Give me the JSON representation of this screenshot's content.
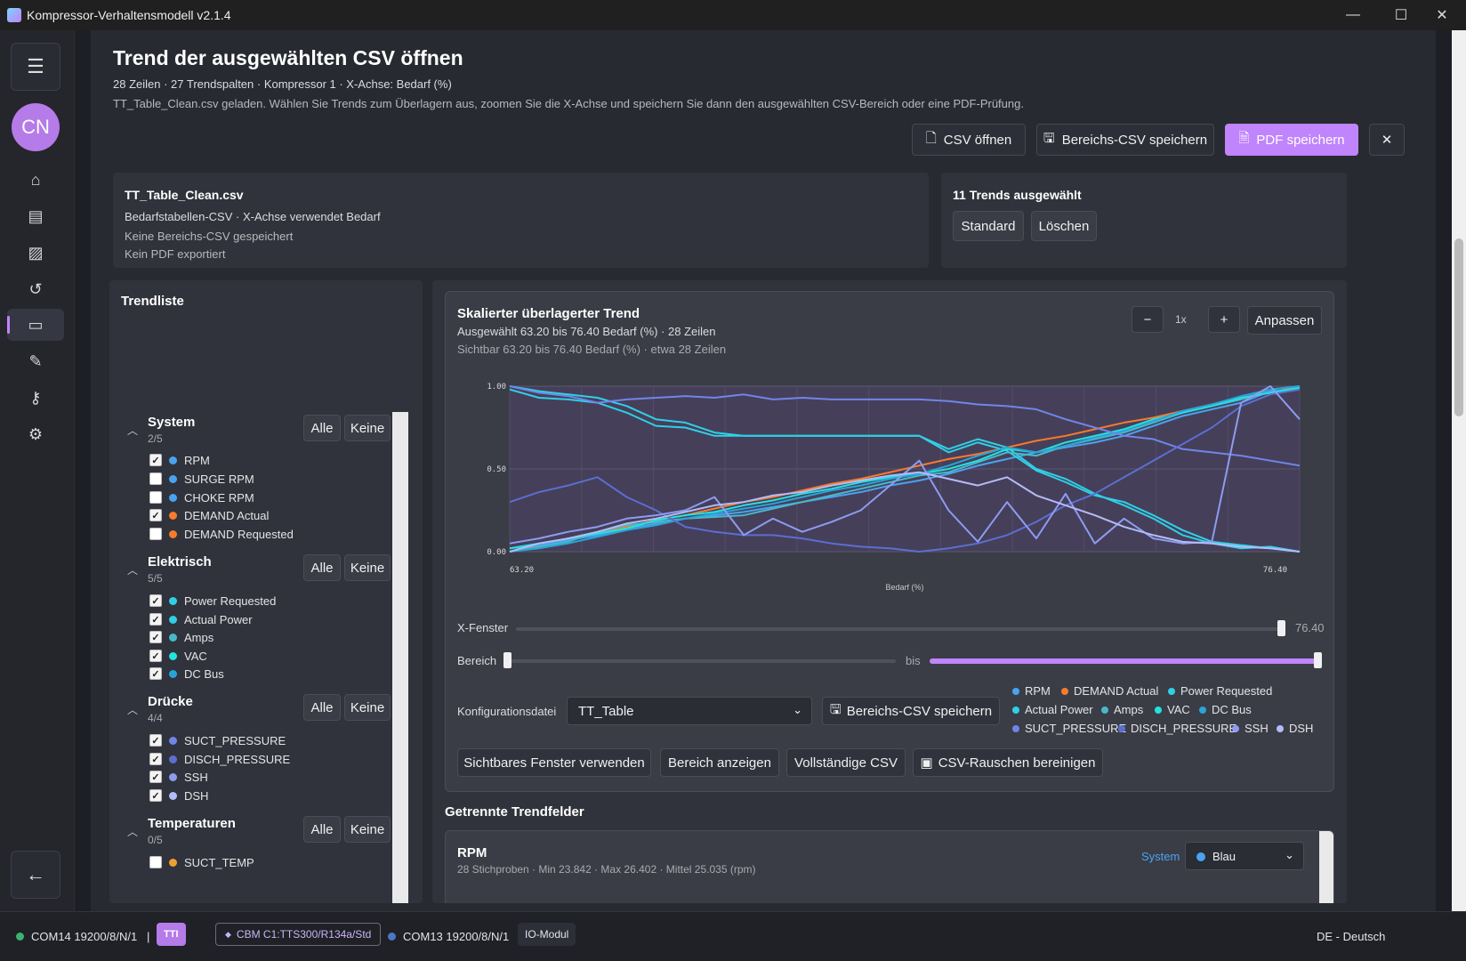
{
  "window": {
    "title": "Kompressor-Verhaltensmodell v2.1.4"
  },
  "rail": {
    "avatar_initials": "CN"
  },
  "header": {
    "title": "Trend der ausgewählten CSV öffnen",
    "summary": "28 Zeilen · 27 Trendspalten · Kompressor 1 · X-Achse: Bedarf (%)",
    "instructions": "TT_Table_Clean.csv geladen. Wählen Sie Trends zum Überlagern aus, zoomen Sie die X-Achse und speichern Sie dann den ausgewählten CSV-Bereich oder eine PDF-Prüfung.",
    "open_csv": "CSV öffnen",
    "save_range_csv": "Bereichs-CSV speichern",
    "save_pdf": "PDF speichern",
    "close": "✕"
  },
  "file_card": {
    "name": "TT_Table_Clean.csv",
    "type": "Bedarfstabellen-CSV · X-Achse verwendet Bedarf",
    "range_status": "Keine Bereichs-CSV gespeichert",
    "pdf_status": "Kein PDF exportiert"
  },
  "selection_card": {
    "title": "11 Trends ausgewählt",
    "standard": "Standard",
    "clear": "Löschen"
  },
  "trendlist": {
    "title": "Trendliste",
    "all": "Alle",
    "none": "Keine",
    "groups": [
      {
        "name": "System",
        "count": "2/5",
        "items": [
          {
            "label": "RPM",
            "checked": true,
            "color": "#4aa3f0"
          },
          {
            "label": "SURGE RPM",
            "checked": false,
            "color": "#4aa3f0"
          },
          {
            "label": "CHOKE RPM",
            "checked": false,
            "color": "#4aa3f0"
          },
          {
            "label": "DEMAND Actual",
            "checked": true,
            "color": "#f97a2c"
          },
          {
            "label": "DEMAND Requested",
            "checked": false,
            "color": "#f97a2c"
          }
        ]
      },
      {
        "name": "Elektrisch",
        "count": "5/5",
        "items": [
          {
            "label": "Power Requested",
            "checked": true,
            "color": "#2fd0e6"
          },
          {
            "label": "Actual Power",
            "checked": true,
            "color": "#2fd0e6"
          },
          {
            "label": "Amps",
            "checked": true,
            "color": "#2fd0e6"
          },
          {
            "label": "VAC",
            "checked": true,
            "color": "#2fd0e6"
          },
          {
            "label": "DC Bus",
            "checked": true,
            "color": "#2fd0e6"
          }
        ]
      },
      {
        "name": "Drücke",
        "count": "4/4",
        "items": [
          {
            "label": "SUCT_PRESSURE",
            "checked": true,
            "color": "#6f86e8"
          },
          {
            "label": "DISCH_PRESSURE",
            "checked": true,
            "color": "#6f86e8"
          },
          {
            "label": "SSH",
            "checked": true,
            "color": "#6f86e8"
          },
          {
            "label": "DSH",
            "checked": true,
            "color": "#6f86e8"
          }
        ]
      },
      {
        "name": "Temperaturen",
        "count": "0/5",
        "items": [
          {
            "label": "SUCT_TEMP",
            "checked": false,
            "color": "#f0a030"
          }
        ]
      }
    ]
  },
  "chart": {
    "title": "Skalierter überlagerter Trend",
    "selected": "Ausgewählt 63.20 bis 76.40 Bedarf (%) · 28 Zeilen",
    "visible": "Sichtbar 63.20 bis 76.40 Bedarf (%) · etwa 28 Zeilen",
    "zoom": "1x",
    "zoom_out": "−",
    "zoom_in": "+",
    "fit": "Anpassen",
    "xwindow_label": "X-Fenster",
    "xwindow_value": "76.40",
    "range_label": "Bereich",
    "range_to": "bis",
    "config_label": "Konfigurationsdatei",
    "config_value": "TT_Table",
    "save_range_csv": "Bereichs-CSV speichern",
    "use_visible": "Sichtbares Fenster verwenden",
    "show_range": "Bereich anzeigen",
    "full_csv": "Vollständige CSV",
    "clean_noise": "CSV-Rauschen bereinigen"
  },
  "chart_data": {
    "type": "line",
    "xlabel": "Bedarf (%)",
    "ylabel": "",
    "xlim": [
      63.2,
      76.4
    ],
    "ylim": [
      0,
      1
    ],
    "yticks": [
      "1.00",
      "0.50",
      "0.00"
    ],
    "xticks": [
      "63.20",
      "76.40"
    ],
    "grid": true,
    "series": [
      {
        "name": "DEMAND Actual",
        "color": "#f97a2c",
        "values": [
          0.0,
          0.04,
          0.08,
          0.11,
          0.15,
          0.19,
          0.22,
          0.26,
          0.3,
          0.33,
          0.37,
          0.41,
          0.44,
          0.48,
          0.52,
          0.56,
          0.59,
          0.63,
          0.67,
          0.7,
          0.74,
          0.78,
          0.81,
          0.85,
          0.89,
          0.93,
          0.96,
          1.0
        ]
      },
      {
        "name": "RPM",
        "color": "#4aa3f0",
        "values": [
          0.02,
          0.04,
          0.07,
          0.1,
          0.14,
          0.17,
          0.2,
          0.22,
          0.24,
          0.27,
          0.3,
          0.33,
          0.36,
          0.4,
          0.43,
          0.47,
          0.52,
          0.56,
          0.6,
          0.63,
          0.66,
          0.7,
          0.76,
          0.82,
          0.86,
          0.9,
          0.97,
          0.98
        ]
      },
      {
        "name": "Power Requested",
        "color": "#2fd0e6",
        "values": [
          1.0,
          0.97,
          0.95,
          0.93,
          0.88,
          0.8,
          0.78,
          0.72,
          0.7,
          0.7,
          0.7,
          0.7,
          0.7,
          0.7,
          0.7,
          0.62,
          0.68,
          0.63,
          0.5,
          0.44,
          0.35,
          0.28,
          0.2,
          0.1,
          0.05,
          0.02,
          0.03,
          0.0
        ]
      },
      {
        "name": "Actual Power",
        "color": "#2fd0e6",
        "values": [
          0.98,
          0.93,
          0.92,
          0.9,
          0.84,
          0.76,
          0.75,
          0.7,
          0.7,
          0.7,
          0.7,
          0.7,
          0.7,
          0.7,
          0.7,
          0.6,
          0.66,
          0.61,
          0.49,
          0.42,
          0.34,
          0.3,
          0.22,
          0.13,
          0.06,
          0.04,
          0.02,
          0.0
        ]
      },
      {
        "name": "Amps",
        "color": "#49b8c8",
        "values": [
          0.0,
          0.03,
          0.06,
          0.12,
          0.16,
          0.18,
          0.2,
          0.21,
          0.22,
          0.26,
          0.3,
          0.34,
          0.38,
          0.42,
          0.46,
          0.48,
          0.54,
          0.6,
          0.58,
          0.64,
          0.68,
          0.72,
          0.78,
          0.84,
          0.88,
          0.92,
          0.98,
          1.0
        ]
      },
      {
        "name": "VAC",
        "color": "#22e3e0",
        "values": [
          0.02,
          0.05,
          0.08,
          0.11,
          0.14,
          0.19,
          0.22,
          0.24,
          0.28,
          0.31,
          0.35,
          0.38,
          0.42,
          0.45,
          0.47,
          0.5,
          0.55,
          0.62,
          0.6,
          0.66,
          0.7,
          0.74,
          0.8,
          0.84,
          0.88,
          0.93,
          0.96,
          0.99
        ]
      },
      {
        "name": "DC Bus",
        "color": "#2aa4d8",
        "values": [
          0.0,
          0.02,
          0.05,
          0.09,
          0.13,
          0.16,
          0.2,
          0.23,
          0.26,
          0.29,
          0.33,
          0.37,
          0.4,
          0.44,
          0.47,
          0.52,
          0.58,
          0.63,
          0.6,
          0.64,
          0.69,
          0.73,
          0.79,
          0.85,
          0.89,
          0.94,
          0.98,
          1.0
        ]
      },
      {
        "name": "SUCT_PRESSURE",
        "color": "#6f86e8",
        "values": [
          1.0,
          0.96,
          0.94,
          0.9,
          0.92,
          0.93,
          0.94,
          0.93,
          0.95,
          0.92,
          0.93,
          0.92,
          0.92,
          0.92,
          0.92,
          0.91,
          0.89,
          0.88,
          0.86,
          0.8,
          0.75,
          0.7,
          0.68,
          0.62,
          0.6,
          0.58,
          0.55,
          0.52
        ]
      },
      {
        "name": "DISCH_PRESSURE",
        "color": "#5a6fd0",
        "values": [
          0.3,
          0.36,
          0.4,
          0.45,
          0.33,
          0.25,
          0.15,
          0.12,
          0.1,
          0.1,
          0.08,
          0.05,
          0.03,
          0.02,
          0.0,
          0.02,
          0.05,
          0.1,
          0.18,
          0.28,
          0.35,
          0.45,
          0.55,
          0.65,
          0.75,
          0.88,
          0.95,
          0.98
        ]
      },
      {
        "name": "SSH",
        "color": "#8d9cf0",
        "values": [
          0.05,
          0.08,
          0.12,
          0.15,
          0.2,
          0.22,
          0.25,
          0.33,
          0.1,
          0.2,
          0.12,
          0.18,
          0.25,
          0.4,
          0.55,
          0.25,
          0.06,
          0.3,
          0.08,
          0.35,
          0.05,
          0.2,
          0.08,
          0.05,
          0.06,
          0.9,
          1.0,
          0.8
        ]
      },
      {
        "name": "DSH",
        "color": "#b3bcf8",
        "values": [
          0.0,
          0.05,
          0.08,
          0.12,
          0.17,
          0.2,
          0.24,
          0.28,
          0.3,
          0.34,
          0.36,
          0.4,
          0.43,
          0.46,
          0.48,
          0.44,
          0.4,
          0.45,
          0.34,
          0.28,
          0.22,
          0.15,
          0.1,
          0.06,
          0.05,
          0.03,
          0.02,
          0.0
        ]
      }
    ]
  },
  "legend": [
    {
      "label": "RPM",
      "color": "#4aa3f0"
    },
    {
      "label": "DEMAND Actual",
      "color": "#f97a2c"
    },
    {
      "label": "Power Requested",
      "color": "#2fd0e6"
    },
    {
      "label": "Actual Power",
      "color": "#2fd0e6"
    },
    {
      "label": "Amps",
      "color": "#49b8c8"
    },
    {
      "label": "VAC",
      "color": "#22e3e0"
    },
    {
      "label": "DC Bus",
      "color": "#2aa4d8"
    },
    {
      "label": "SUCT_PRESSURE",
      "color": "#6f86e8"
    },
    {
      "label": "DISCH_PRESSURE",
      "color": "#5a6fd0"
    },
    {
      "label": "SSH",
      "color": "#8d9cf0"
    },
    {
      "label": "DSH",
      "color": "#b3bcf8"
    }
  ],
  "separate": {
    "title": "Getrennte Trendfelder",
    "first_name": "RPM",
    "first_stats": "28 Stichproben · Min 23.842 · Max 26.402 · Mittel 25.035 (rpm)",
    "first_group": "System",
    "first_color": "Blau"
  },
  "status": {
    "com1": "COM14 19200/8/N/1",
    "sep": "|",
    "tt": "TTI",
    "cbm": "CBM C1:TTS300/R134a/Std",
    "com2": "COM13 19200/8/N/1",
    "io": "IO-Modul",
    "lang": "DE - Deutsch"
  }
}
